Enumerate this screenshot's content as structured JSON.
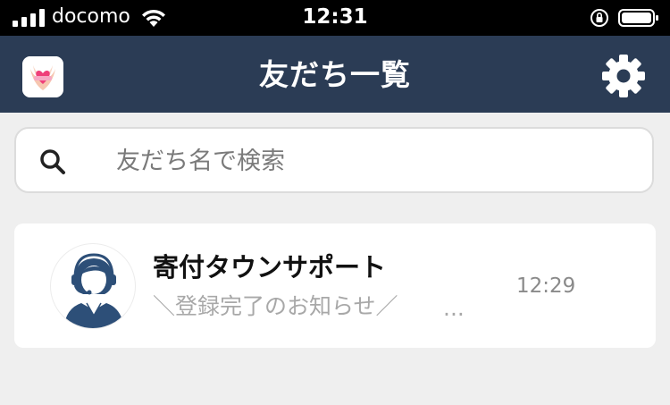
{
  "status_bar": {
    "carrier": "docomo",
    "time": "12:31",
    "icons": [
      "signal-icon",
      "wifi-icon",
      "rotation-lock-icon",
      "battery-icon"
    ]
  },
  "header": {
    "title": "友だち一覧",
    "background": "#2b3c55",
    "left_icon": "app-logo-icon",
    "right_icon": "gear-icon"
  },
  "search": {
    "placeholder": "友だち名で検索",
    "value": "",
    "icon": "search-icon"
  },
  "friends": [
    {
      "name": "寄付タウンサポート",
      "last_message": "＼登録完了のお知らせ／",
      "truncation": "...",
      "time": "12:29",
      "avatar_icon": "support-operator-avatar",
      "avatar_color": "#2d4f78"
    }
  ]
}
